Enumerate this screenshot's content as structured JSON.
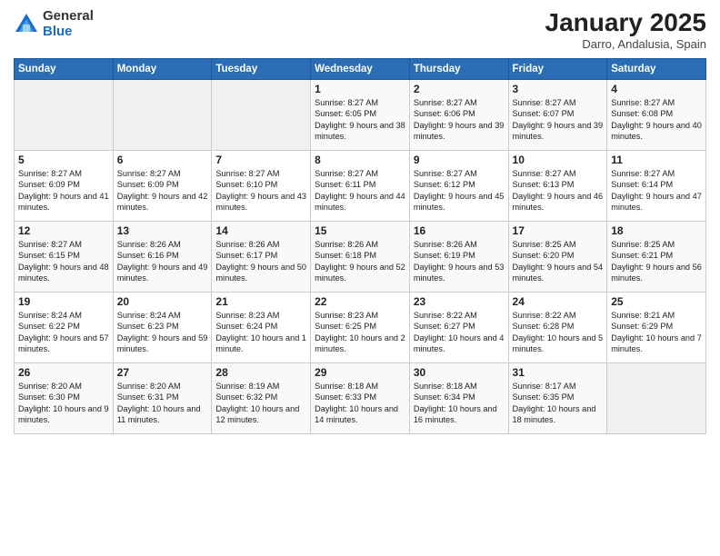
{
  "header": {
    "logo_general": "General",
    "logo_blue": "Blue",
    "title": "January 2025",
    "subtitle": "Darro, Andalusia, Spain"
  },
  "days_of_week": [
    "Sunday",
    "Monday",
    "Tuesday",
    "Wednesday",
    "Thursday",
    "Friday",
    "Saturday"
  ],
  "weeks": [
    [
      {
        "day": "",
        "info": ""
      },
      {
        "day": "",
        "info": ""
      },
      {
        "day": "",
        "info": ""
      },
      {
        "day": "1",
        "info": "Sunrise: 8:27 AM\nSunset: 6:05 PM\nDaylight: 9 hours and 38 minutes."
      },
      {
        "day": "2",
        "info": "Sunrise: 8:27 AM\nSunset: 6:06 PM\nDaylight: 9 hours and 39 minutes."
      },
      {
        "day": "3",
        "info": "Sunrise: 8:27 AM\nSunset: 6:07 PM\nDaylight: 9 hours and 39 minutes."
      },
      {
        "day": "4",
        "info": "Sunrise: 8:27 AM\nSunset: 6:08 PM\nDaylight: 9 hours and 40 minutes."
      }
    ],
    [
      {
        "day": "5",
        "info": "Sunrise: 8:27 AM\nSunset: 6:09 PM\nDaylight: 9 hours and 41 minutes."
      },
      {
        "day": "6",
        "info": "Sunrise: 8:27 AM\nSunset: 6:09 PM\nDaylight: 9 hours and 42 minutes."
      },
      {
        "day": "7",
        "info": "Sunrise: 8:27 AM\nSunset: 6:10 PM\nDaylight: 9 hours and 43 minutes."
      },
      {
        "day": "8",
        "info": "Sunrise: 8:27 AM\nSunset: 6:11 PM\nDaylight: 9 hours and 44 minutes."
      },
      {
        "day": "9",
        "info": "Sunrise: 8:27 AM\nSunset: 6:12 PM\nDaylight: 9 hours and 45 minutes."
      },
      {
        "day": "10",
        "info": "Sunrise: 8:27 AM\nSunset: 6:13 PM\nDaylight: 9 hours and 46 minutes."
      },
      {
        "day": "11",
        "info": "Sunrise: 8:27 AM\nSunset: 6:14 PM\nDaylight: 9 hours and 47 minutes."
      }
    ],
    [
      {
        "day": "12",
        "info": "Sunrise: 8:27 AM\nSunset: 6:15 PM\nDaylight: 9 hours and 48 minutes."
      },
      {
        "day": "13",
        "info": "Sunrise: 8:26 AM\nSunset: 6:16 PM\nDaylight: 9 hours and 49 minutes."
      },
      {
        "day": "14",
        "info": "Sunrise: 8:26 AM\nSunset: 6:17 PM\nDaylight: 9 hours and 50 minutes."
      },
      {
        "day": "15",
        "info": "Sunrise: 8:26 AM\nSunset: 6:18 PM\nDaylight: 9 hours and 52 minutes."
      },
      {
        "day": "16",
        "info": "Sunrise: 8:26 AM\nSunset: 6:19 PM\nDaylight: 9 hours and 53 minutes."
      },
      {
        "day": "17",
        "info": "Sunrise: 8:25 AM\nSunset: 6:20 PM\nDaylight: 9 hours and 54 minutes."
      },
      {
        "day": "18",
        "info": "Sunrise: 8:25 AM\nSunset: 6:21 PM\nDaylight: 9 hours and 56 minutes."
      }
    ],
    [
      {
        "day": "19",
        "info": "Sunrise: 8:24 AM\nSunset: 6:22 PM\nDaylight: 9 hours and 57 minutes."
      },
      {
        "day": "20",
        "info": "Sunrise: 8:24 AM\nSunset: 6:23 PM\nDaylight: 9 hours and 59 minutes."
      },
      {
        "day": "21",
        "info": "Sunrise: 8:23 AM\nSunset: 6:24 PM\nDaylight: 10 hours and 1 minute."
      },
      {
        "day": "22",
        "info": "Sunrise: 8:23 AM\nSunset: 6:25 PM\nDaylight: 10 hours and 2 minutes."
      },
      {
        "day": "23",
        "info": "Sunrise: 8:22 AM\nSunset: 6:27 PM\nDaylight: 10 hours and 4 minutes."
      },
      {
        "day": "24",
        "info": "Sunrise: 8:22 AM\nSunset: 6:28 PM\nDaylight: 10 hours and 5 minutes."
      },
      {
        "day": "25",
        "info": "Sunrise: 8:21 AM\nSunset: 6:29 PM\nDaylight: 10 hours and 7 minutes."
      }
    ],
    [
      {
        "day": "26",
        "info": "Sunrise: 8:20 AM\nSunset: 6:30 PM\nDaylight: 10 hours and 9 minutes."
      },
      {
        "day": "27",
        "info": "Sunrise: 8:20 AM\nSunset: 6:31 PM\nDaylight: 10 hours and 11 minutes."
      },
      {
        "day": "28",
        "info": "Sunrise: 8:19 AM\nSunset: 6:32 PM\nDaylight: 10 hours and 12 minutes."
      },
      {
        "day": "29",
        "info": "Sunrise: 8:18 AM\nSunset: 6:33 PM\nDaylight: 10 hours and 14 minutes."
      },
      {
        "day": "30",
        "info": "Sunrise: 8:18 AM\nSunset: 6:34 PM\nDaylight: 10 hours and 16 minutes."
      },
      {
        "day": "31",
        "info": "Sunrise: 8:17 AM\nSunset: 6:35 PM\nDaylight: 10 hours and 18 minutes."
      },
      {
        "day": "",
        "info": ""
      }
    ]
  ]
}
